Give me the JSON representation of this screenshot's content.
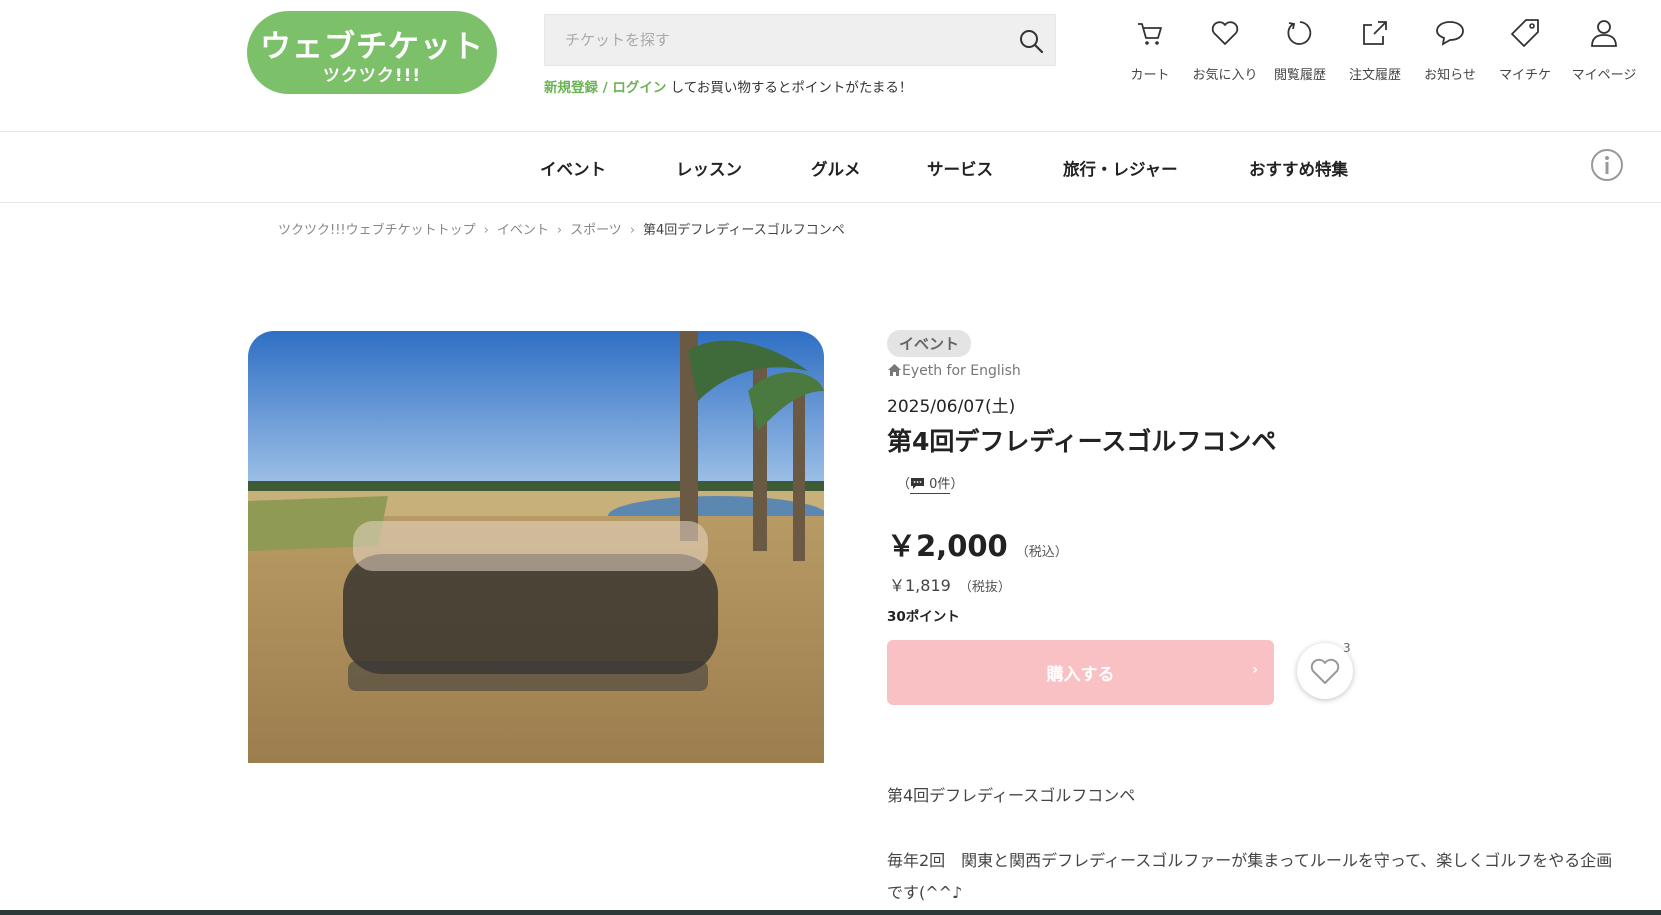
{
  "logo": {
    "line1": "ウェブチケット",
    "line2": "ツクツク!!!"
  },
  "search": {
    "placeholder": "チケットを探す"
  },
  "promo": {
    "register": "新規登録",
    "slash": " / ",
    "login": "ログイン",
    "rest": " してお買い物するとポイントがたまる！"
  },
  "header_icons": [
    {
      "icon": "cart-icon",
      "label": "カート"
    },
    {
      "icon": "heart-icon",
      "label": "お気に入り"
    },
    {
      "icon": "history-icon",
      "label": "閲覧履歴"
    },
    {
      "icon": "share-icon",
      "label": "注文履歴"
    },
    {
      "icon": "chat-icon",
      "label": "お知らせ"
    },
    {
      "icon": "tag-icon",
      "label": "マイチケ"
    },
    {
      "icon": "user-icon",
      "label": "マイページ"
    }
  ],
  "nav": [
    "イベント",
    "レッスン",
    "グルメ",
    "サービス",
    "旅行・レジャー",
    "おすすめ特集"
  ],
  "breadcrumb": [
    "ツクツク!!!ウェブチケットトップ",
    "イベント",
    "スポーツ",
    "第4回デフレディースゴルフコンペ"
  ],
  "product": {
    "category": "イベント",
    "organizer": "Eyeth for English",
    "date": "2025/06/07(土)",
    "title": "第4回デフレディースゴルフコンペ",
    "reviews_open": "（",
    "reviews_count": "0件",
    "reviews_close": "）",
    "price_incl": "￥2,000",
    "price_incl_note": "（税込）",
    "price_excl": "￥1,819",
    "price_excl_note": "（税抜）",
    "points": "30ポイント",
    "buy_label": "購入する",
    "buy_chevron": "›",
    "favorite_count": "3"
  },
  "description": {
    "p1": "第4回デフレディースゴルフコンペ",
    "p2": "毎年2回　関東と関西デフレディースゴルファーが集まってルールを守って、楽しくゴルフをやる企画です(^^♪"
  },
  "colors": {
    "brand_green": "#7cc06a",
    "buy_button": "#f9c1c3",
    "tag_bg": "#e4e4e4"
  }
}
